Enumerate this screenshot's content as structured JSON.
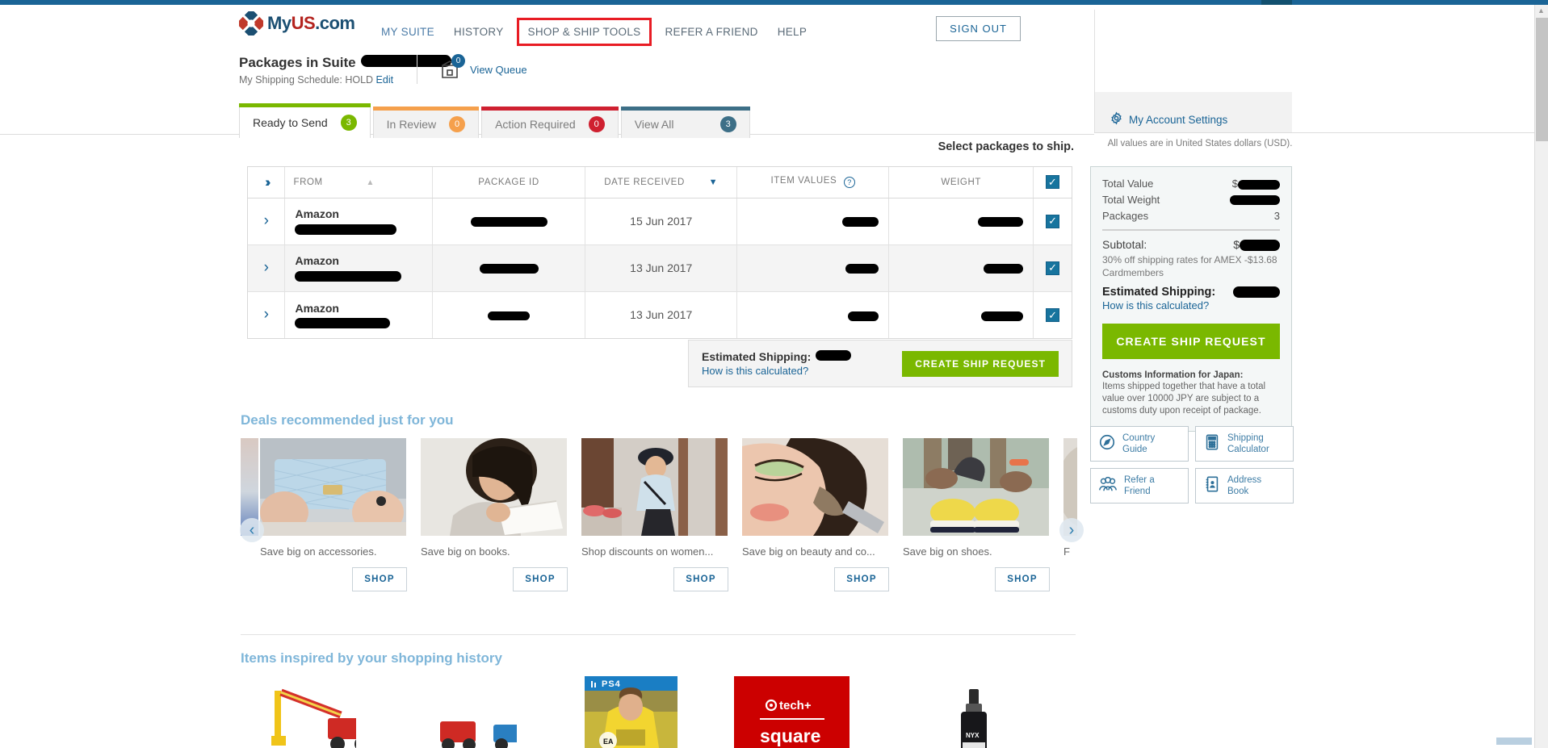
{
  "brand": {
    "logo_my": "My",
    "logo_us": "US",
    "logo_com": ".com",
    "accent_blue": "#1a6496",
    "accent_red": "#b4241f",
    "accent_green": "#7ab800",
    "highlight_box": "#e81c24"
  },
  "nav": {
    "items": [
      {
        "label": "MY SUITE",
        "style": "link"
      },
      {
        "label": "HISTORY",
        "style": "muted"
      },
      {
        "label": "SHOP & SHIP TOOLS",
        "style": "boxed"
      },
      {
        "label": "REFER A FRIEND",
        "style": "muted"
      },
      {
        "label": "HELP",
        "style": "muted"
      }
    ],
    "sign_out": "SIGN OUT"
  },
  "suite": {
    "title_prefix": "Packages in Suite",
    "title_value": "",
    "schedule_prefix": "My Shipping Schedule: HOLD",
    "schedule_edit": "Edit",
    "queue_count": "0",
    "queue_label": "View Queue"
  },
  "account": {
    "settings_label": "My Account Settings",
    "usd_note": "All values are in United States dollars (USD)."
  },
  "tabs": [
    {
      "label": "Ready to Send",
      "count": "3",
      "color": "#7ab800",
      "active": true
    },
    {
      "label": "In Review",
      "count": "0",
      "color": "#f5a04c",
      "active": false
    },
    {
      "label": "Action Required",
      "count": "0",
      "color": "#cf2030",
      "active": false
    },
    {
      "label": "View All",
      "count": "3",
      "color": "#3d6f87",
      "active": false
    }
  ],
  "table": {
    "select_heading": "Select packages to ship.",
    "columns": [
      {
        "key": "expand",
        "label": ""
      },
      {
        "key": "from",
        "label": "FROM",
        "sort": "asc"
      },
      {
        "key": "package_id",
        "label": "PACKAGE ID"
      },
      {
        "key": "date_received",
        "label": "DATE RECEIVED",
        "sort": "desc"
      },
      {
        "key": "item_values",
        "label": "ITEM VALUES",
        "help": "?"
      },
      {
        "key": "weight",
        "label": "WEIGHT"
      },
      {
        "key": "select",
        "label": ""
      }
    ],
    "header_checked": true,
    "rows": [
      {
        "from": "Amazon",
        "from_sub": "",
        "package_id": "",
        "date_received": "15 Jun 2017",
        "item_value": "",
        "weight": "",
        "checked": true
      },
      {
        "from": "Amazon",
        "from_sub": "",
        "package_id": "",
        "date_received": "13 Jun 2017",
        "item_value": "",
        "weight": "",
        "checked": true
      },
      {
        "from": "Amazon",
        "from_sub": "",
        "package_id": "",
        "date_received": "13 Jun 2017",
        "item_value": "",
        "weight": "",
        "checked": true
      }
    ]
  },
  "estimate_bar": {
    "label": "Estimated Shipping:",
    "value": "",
    "how_link": "How is this calculated?",
    "button": "CREATE SHIP REQUEST"
  },
  "summary": {
    "total_value_label": "Total Value",
    "total_value": "$",
    "total_weight_label": "Total Weight",
    "total_weight": "",
    "packages_label": "Packages",
    "packages": "3",
    "subtotal_label": "Subtotal:",
    "subtotal": "$",
    "amex_note": "30% off shipping rates for AMEX -$13.68 Cardmembers",
    "estimated_label": "Estimated Shipping:",
    "estimated": "",
    "how_link": "How is this calculated?",
    "button": "CREATE SHIP REQUEST",
    "customs_heading": "Customs Information for Japan:",
    "customs_body": "Items shipped together that have a total value over 10000 JPY are subject to a customs duty upon receipt of package."
  },
  "tiles": [
    {
      "label_1": "Country",
      "label_2": "Guide",
      "icon": "compass-icon"
    },
    {
      "label_1": "Shipping",
      "label_2": "Calculator",
      "icon": "calculator-icon"
    },
    {
      "label_1": "Refer a",
      "label_2": "Friend",
      "icon": "people-icon"
    },
    {
      "label_1": "Address",
      "label_2": "Book",
      "icon": "address-book-icon"
    }
  ],
  "deals": {
    "title": "Deals recommended just for you",
    "shop_label": "SHOP",
    "prev_icon": "chevron-left-icon",
    "next_icon": "chevron-right-icon",
    "cards": [
      {
        "caption": "Save big on accessories.",
        "img": "handbag-photo"
      },
      {
        "caption": "Save big on books.",
        "img": "woman-reading-photo"
      },
      {
        "caption": "Shop discounts on women...",
        "img": "woman-shopping-photo"
      },
      {
        "caption": "Save big on beauty and co...",
        "img": "makeup-brush-photo"
      },
      {
        "caption": "Save big on shoes.",
        "img": "yellow-sneakers-photo"
      },
      {
        "caption": "F",
        "img": "partial-photo"
      }
    ]
  },
  "inspired": {
    "title": "Items inspired by your shopping history",
    "cards": [
      {
        "img": "toy-crane-truck"
      },
      {
        "img": "toy-construction-set"
      },
      {
        "img": "ps4-fifa-game",
        "badge": "PS4"
      },
      {
        "img": "tech-square-red",
        "line1": "tech+",
        "line2": "square"
      },
      {
        "img": "nyx-spray-bottle",
        "brand": "NYX"
      }
    ]
  }
}
